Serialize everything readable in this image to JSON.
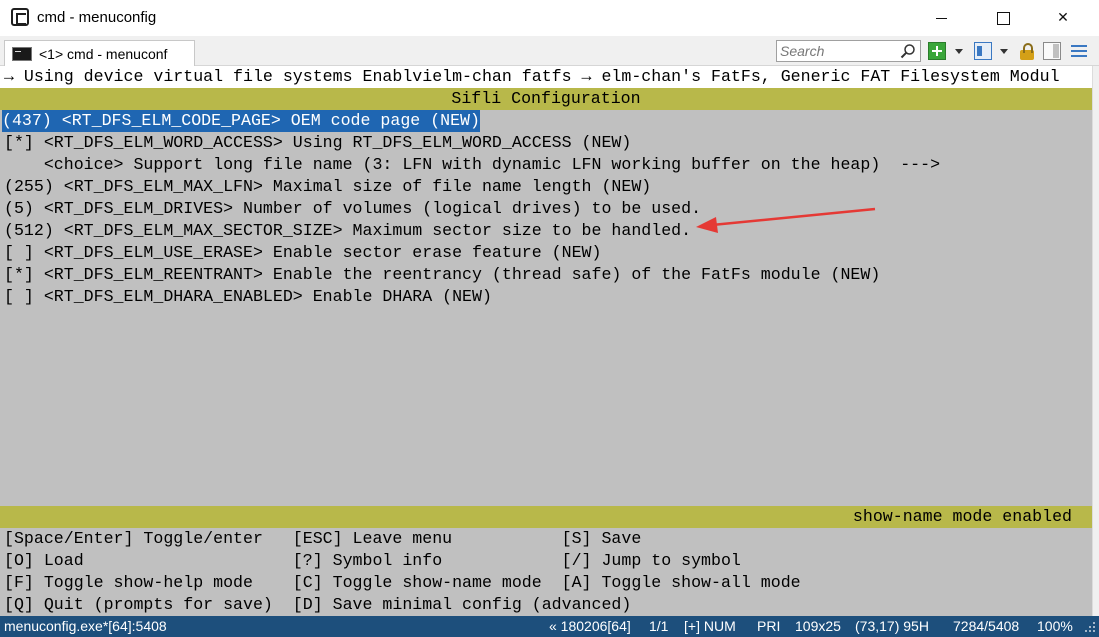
{
  "window": {
    "title": "cmd - menuconfig"
  },
  "tabbar": {
    "tab_label": "<1> cmd - menuconf",
    "search_placeholder": "Search",
    "icons": [
      "terminal-icon",
      "search-icon",
      "add-console-icon",
      "window-layout-icon",
      "lock-icon",
      "panel-icon",
      "hamburger-menu-icon"
    ]
  },
  "menuconfig": {
    "breadcrumb": "→ Using device virtual file systems Enablvielm-chan fatfs → elm-chan's FatFs, Generic FAT Filesystem Modul",
    "title": "Sifli Configuration",
    "items": [
      {
        "text": "(437) <RT_DFS_ELM_CODE_PAGE> OEM code page (NEW)",
        "selected": true
      },
      {
        "text": "[*] <RT_DFS_ELM_WORD_ACCESS> Using RT_DFS_ELM_WORD_ACCESS (NEW)",
        "selected": false
      },
      {
        "text": "    <choice> Support long file name (3: LFN with dynamic LFN working buffer on the heap)  --->",
        "selected": false
      },
      {
        "text": "(255) <RT_DFS_ELM_MAX_LFN> Maximal size of file name length (NEW)",
        "selected": false
      },
      {
        "text": "(5) <RT_DFS_ELM_DRIVES> Number of volumes (logical drives) to be used.",
        "selected": false
      },
      {
        "text": "(512) <RT_DFS_ELM_MAX_SECTOR_SIZE> Maximum sector size to be handled.",
        "selected": false
      },
      {
        "text": "[ ] <RT_DFS_ELM_USE_ERASE> Enable sector erase feature (NEW)",
        "selected": false
      },
      {
        "text": "[*] <RT_DFS_ELM_REENTRANT> Enable the reentrancy (thread safe) of the FatFs module (NEW)",
        "selected": false
      },
      {
        "text": "[ ] <RT_DFS_ELM_DHARA_ENABLED> Enable DHARA (NEW)",
        "selected": false
      }
    ],
    "mode_status": "show-name mode enabled",
    "help_lines": [
      "[Space/Enter] Toggle/enter   [ESC] Leave menu           [S] Save",
      "[O] Load                     [?] Symbol info            [/] Jump to symbol",
      "[F] Toggle show-help mode    [C] Toggle show-name mode  [A] Toggle show-all mode",
      "[Q] Quit (prompts for save)  [D] Save minimal config (advanced)"
    ]
  },
  "statusbar": {
    "process": "menuconfig.exe*[64]:5408",
    "build": "« 180206[64]",
    "pane": "1/1",
    "keys": "[+] NUM",
    "priority": "PRI",
    "size": "109x25",
    "cursor": "(73,17) 95H",
    "pid": "7284/5408",
    "zoom": "100%"
  },
  "colors": {
    "console_bg": "#c0c0c0",
    "bar_yellow": "#b8b84a",
    "selection": "#1f66b2",
    "status_bg": "#1d4f7c",
    "annotation_arrow": "#e53935"
  }
}
